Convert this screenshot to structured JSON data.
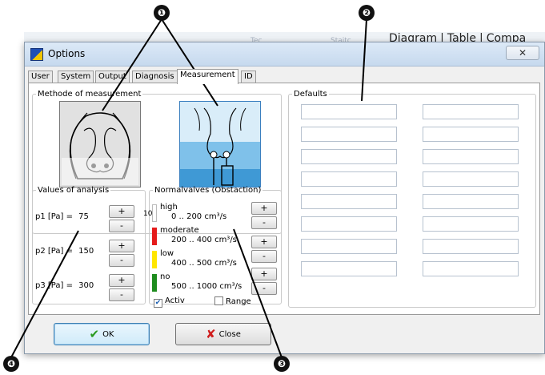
{
  "background_app": {
    "tabs": [
      "Diagram",
      "|",
      "Table",
      "|",
      "Compa"
    ],
    "faint_labels": [
      "Tec",
      "Staitc"
    ]
  },
  "dialog": {
    "title": "Options",
    "close_glyph": "✕",
    "tabs": [
      {
        "label": "User",
        "active": false
      },
      {
        "label": "System",
        "active": false
      },
      {
        "label": "Output",
        "active": false
      },
      {
        "label": "Diagnosis",
        "active": false
      },
      {
        "label": "Measurement",
        "active": true
      },
      {
        "label": "ID",
        "active": false
      }
    ],
    "method": {
      "legend": "Methode of measurement"
    },
    "analysis": {
      "legend": "Values of analysis",
      "rows": [
        {
          "label": "p1 [Pa] =",
          "value": "75"
        },
        {
          "label": "p2 [Pa] =",
          "value": "150"
        },
        {
          "label": "p3 [Pa] =",
          "value": "300"
        }
      ],
      "plus": "+",
      "minus": "-"
    },
    "normalvalues": {
      "legend": "Normalvalves (Obstaction)",
      "items": [
        {
          "label": "high",
          "range": "0 .. 200 cm³/s",
          "color": "#ffffff"
        },
        {
          "label": "moderate",
          "range": "200 .. 400 cm³/s",
          "color": "#e51b1b"
        },
        {
          "label": "low",
          "range": "400 .. 500 cm³/s",
          "color": "#ffe600"
        },
        {
          "label": "no",
          "range": "500 .. 1000 cm³/s",
          "color": "#1e8c1e"
        }
      ],
      "activ": {
        "label": "Activ",
        "checked": true
      },
      "range": {
        "label": "Range",
        "checked": false
      },
      "edge_clip": "10"
    },
    "defaults": {
      "legend": "Defaults",
      "fields": [
        "",
        "",
        "",
        "",
        "",
        "",
        "",
        "",
        "",
        "",
        "",
        "",
        "",
        "",
        "",
        ""
      ]
    },
    "ok_button": {
      "label": "OK",
      "icon": "checkmark-icon",
      "icon_color": "#2a9a1f"
    },
    "close_button": {
      "label": "Close",
      "icon": "x-icon",
      "icon_color": "#d01e1e"
    }
  },
  "callouts": [
    "❶",
    "❷",
    "❸",
    "❹"
  ]
}
